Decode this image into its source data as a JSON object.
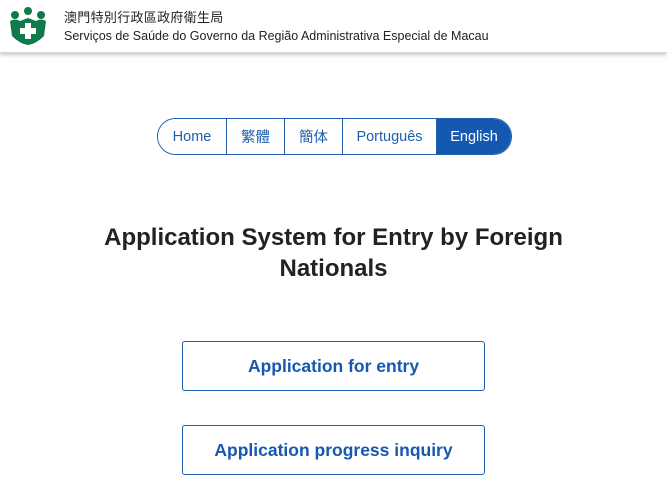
{
  "header": {
    "org_name_zh": "澳門特別行政區政府衛生局",
    "org_name_pt": "Serviços de Saúde do Governo da Região Administrativa Especial de Macau",
    "logo_icon": "health-bureau-logo-icon",
    "logo_color": "#0f7a4a"
  },
  "language_nav": {
    "items": [
      {
        "label": "Home"
      },
      {
        "label": "繁體"
      },
      {
        "label": "簡体"
      },
      {
        "label": "Português"
      },
      {
        "label": "English"
      }
    ],
    "active": "English",
    "accent_color": "#1558b0"
  },
  "main": {
    "title_line1": "Application System for Entry by Foreign",
    "title_line2": "Nationals",
    "buttons": {
      "apply": "Application for entry",
      "inquiry": "Application progress inquiry"
    }
  }
}
